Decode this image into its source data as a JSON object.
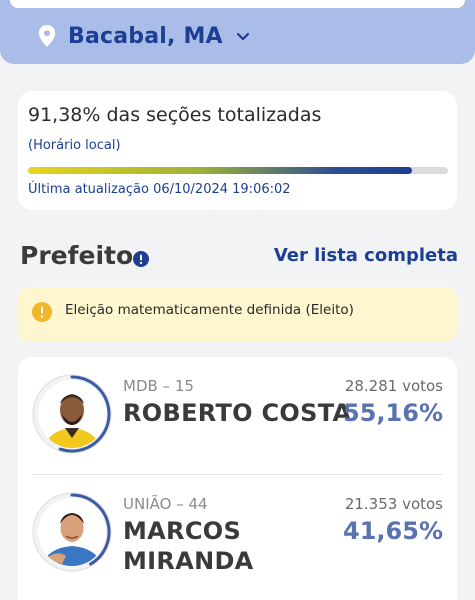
{
  "location": {
    "city": "Bacabal, MA"
  },
  "progress": {
    "sections_text": "91,38% das seções totalizadas",
    "time_note": "(Horário local)",
    "fraction": 0.9138,
    "updated_text": "Última atualização 06/10/2024 19:06:02"
  },
  "section": {
    "title": "Prefeito",
    "list_link": "Ver lista completa"
  },
  "notice": {
    "text": "Eleição matematicamente definida (Eleito)"
  },
  "candidates": [
    {
      "party": "MDB – 15",
      "name": "ROBERTO COSTA",
      "votes": "28.281 votos",
      "pct": "55,16%",
      "share": 0.5516
    },
    {
      "party": "UNIÃO – 44",
      "name": "MARCOS MIRANDA",
      "votes": "21.353 votos",
      "pct": "41,65%",
      "share": 0.4165
    }
  ],
  "colors": {
    "brand_blue": "#1c3f94",
    "banner": "#aabde8",
    "pct_blue": "#5a72b0",
    "notice_bg": "#fdf6cf",
    "warn_yellow": "#f1b72b"
  }
}
